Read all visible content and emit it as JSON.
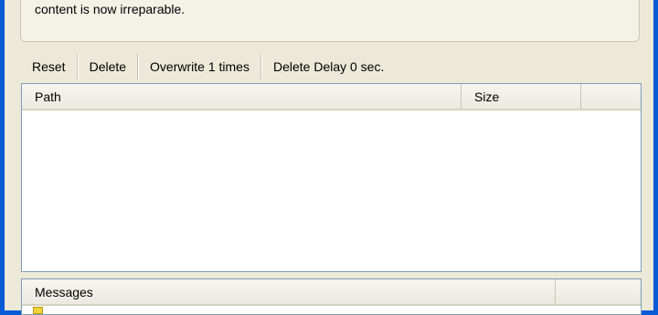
{
  "info": {
    "text": "content is now irreparable."
  },
  "toolbar": {
    "reset": "Reset",
    "delete": "Delete",
    "overwrite": "Overwrite 1 times",
    "delete_delay": "Delete Delay 0 sec."
  },
  "file_list": {
    "columns": [
      "Path",
      "Size"
    ],
    "rows": []
  },
  "messages": {
    "columns": [
      "Messages"
    ]
  }
}
